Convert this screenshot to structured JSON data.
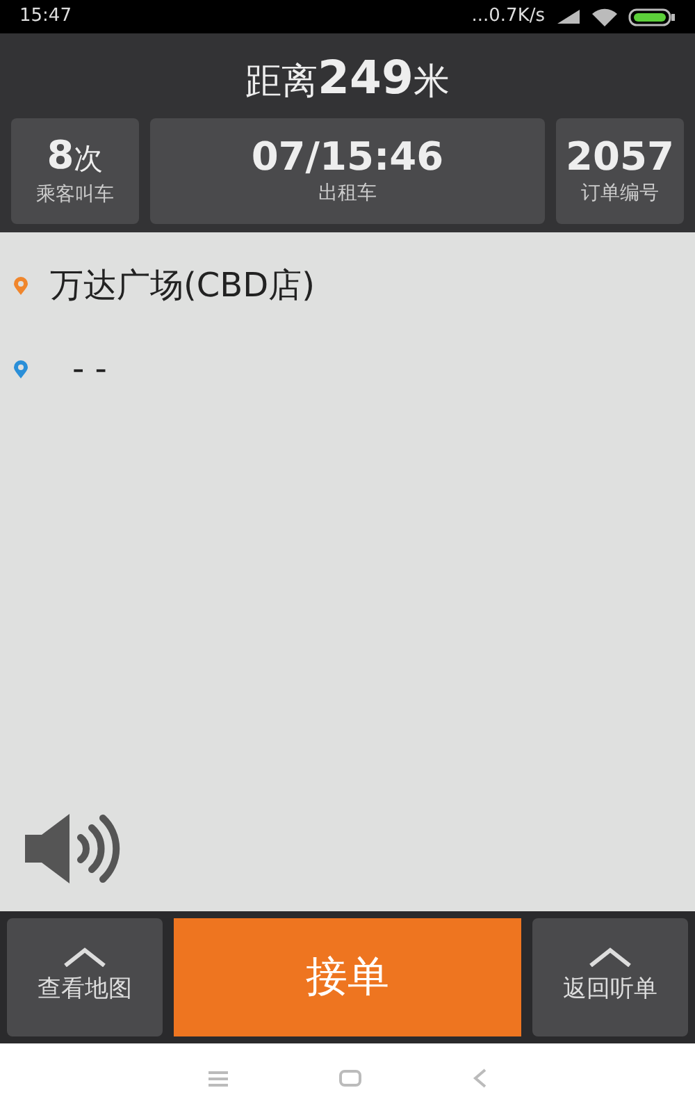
{
  "status_bar": {
    "time": "15:47",
    "network_speed": "...0.7K/s"
  },
  "header": {
    "distance_prefix": "距离",
    "distance_value": "249",
    "distance_unit": "米"
  },
  "stats": [
    {
      "value": "8",
      "unit": "次",
      "label": "乘客叫车",
      "kind": "small"
    },
    {
      "value": "07/15:46",
      "label": "出租车",
      "kind": "wide"
    },
    {
      "value": "2057",
      "label": "订单编号",
      "kind": "small"
    }
  ],
  "route": [
    {
      "kind": "start",
      "color": "#f0862c",
      "text": "万达广场(CBD店)"
    },
    {
      "kind": "end",
      "color": "#2a8fd8",
      "text": "- -"
    }
  ],
  "actions": [
    {
      "kind": "side",
      "label": "查看地图"
    },
    {
      "kind": "primary",
      "label": "接单"
    },
    {
      "kind": "side",
      "label": "返回听单"
    }
  ]
}
